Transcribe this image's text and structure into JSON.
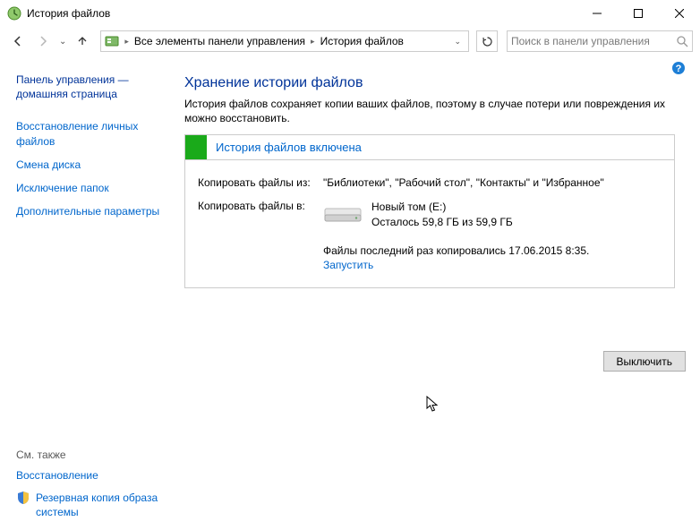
{
  "window": {
    "title": "История файлов"
  },
  "nav": {
    "breadcrumb1": "Все элементы панели управления",
    "breadcrumb2": "История файлов",
    "search_placeholder": "Поиск в панели управления"
  },
  "sidebar": {
    "home": "Панель управления — домашняя страница",
    "links": {
      "restore": "Восстановление личных файлов",
      "change_drive": "Смена диска",
      "exclude": "Исключение папок",
      "advanced": "Дополнительные параметры"
    },
    "seealso_header": "См. также",
    "seealso": {
      "recovery": "Восстановление",
      "backup_image": "Резервная копия образа системы"
    }
  },
  "main": {
    "heading": "Хранение истории файлов",
    "desc": "История файлов сохраняет копии ваших файлов, поэтому в случае потери или повреждения их можно восстановить.",
    "status_title": "История файлов включена",
    "copy_from_label": "Копировать файлы из:",
    "copy_from_value": "\"Библиотеки\", \"Рабочий стол\", \"Контакты\" и \"Избранное\"",
    "copy_to_label": "Копировать файлы в:",
    "drive_name": "Новый том (E:)",
    "drive_space": "Осталось 59,8 ГБ из 59,9 ГБ",
    "last_copy": "Файлы последний раз копировались 17.06.2015 8:35.",
    "run_link": "Запустить",
    "turn_off": "Выключить"
  }
}
